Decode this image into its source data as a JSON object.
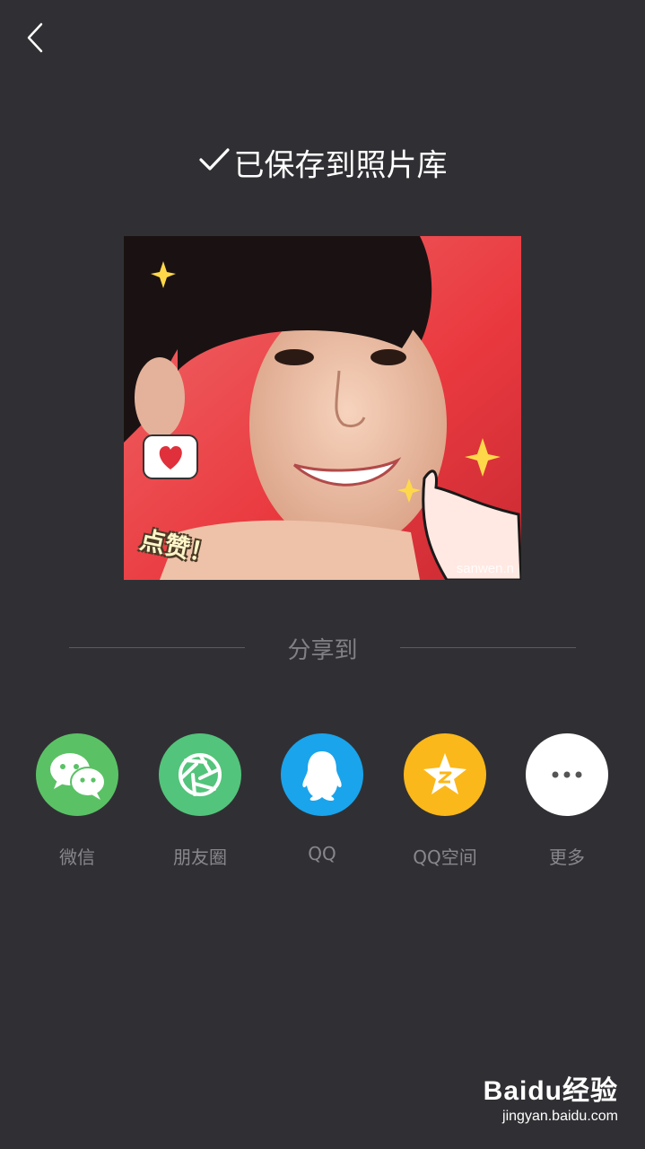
{
  "header": {
    "back_icon": "chevron-left-icon"
  },
  "status": {
    "check_icon": "checkmark-icon",
    "title": "已保存到照片库"
  },
  "photo": {
    "sticker_text": "点赞！",
    "watermark": "sanwen.n"
  },
  "share": {
    "label": "分享到",
    "items": [
      {
        "label": "微信",
        "icon": "wechat-icon",
        "color": "#5ac265"
      },
      {
        "label": "朋友圈",
        "icon": "moments-icon",
        "color": "#53c47b"
      },
      {
        "label": "QQ",
        "icon": "qq-icon",
        "color": "#1aa4ec"
      },
      {
        "label": "QQ空间",
        "icon": "qzone-icon",
        "color": "#fbb81a"
      },
      {
        "label": "更多",
        "icon": "more-icon",
        "color": "#ffffff"
      }
    ]
  },
  "footer": {
    "brand": "Baidu经验",
    "site": "jingyan.baidu.com"
  },
  "colors": {
    "background": "#303034",
    "divider": "#5b5b60",
    "muted_text": "#88888c"
  }
}
